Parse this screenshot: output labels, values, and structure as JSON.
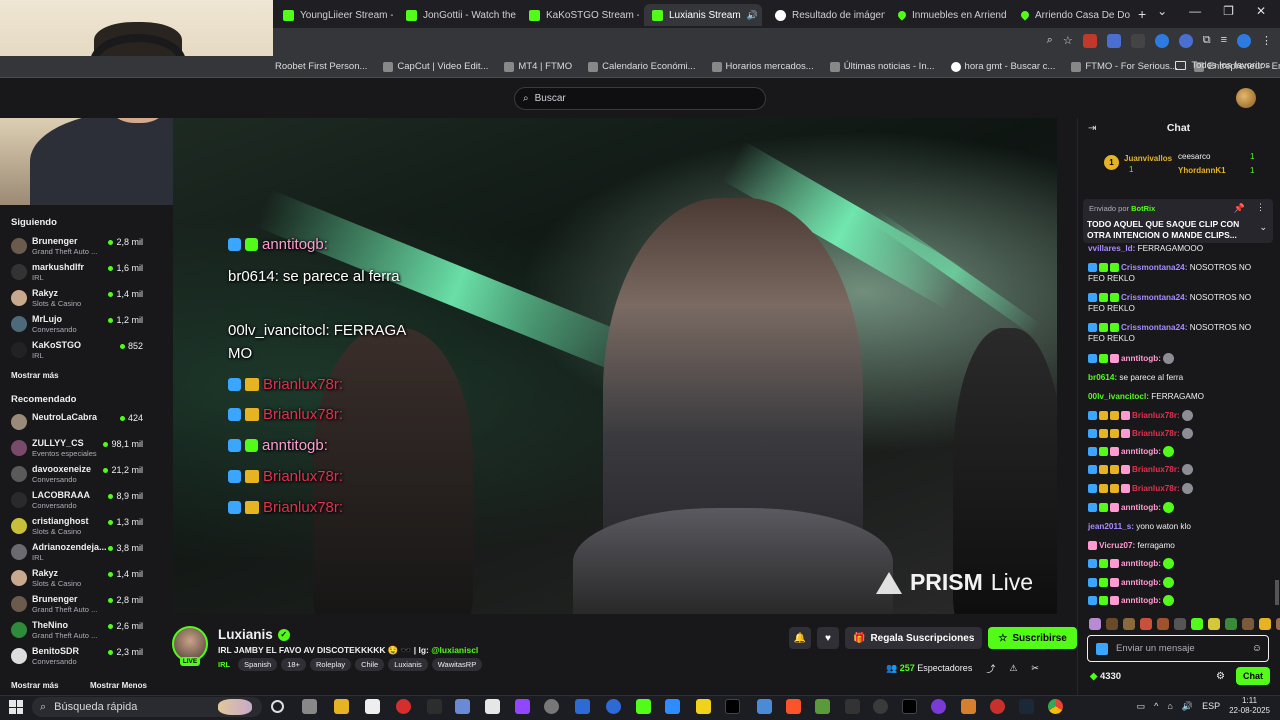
{
  "browser": {
    "tabs": [
      {
        "label": "YoungLiieer Stream -",
        "icon": "kick-icon"
      },
      {
        "label": "JonGottii - Watch the",
        "icon": "kick-icon"
      },
      {
        "label": "KaKoSTGO Stream -",
        "icon": "kick-icon"
      },
      {
        "label": "Luxianis Stream",
        "icon": "kick-icon",
        "active": true
      },
      {
        "label": "Resultado de imágen",
        "icon": "google-icon"
      },
      {
        "label": "Inmuebles en Arriend",
        "icon": "maps-icon"
      },
      {
        "label": "Arriendo Casa De Do",
        "icon": "maps-icon"
      }
    ],
    "new_tab": "+",
    "window_controls": [
      "⌄",
      "—",
      "❐",
      "✕"
    ],
    "bookmarks": [
      "Roobet First Person...",
      "CapCut | Video Edit...",
      "MT4 | FTMO",
      "Calendario Económi...",
      "Horarios mercados...",
      "Últimas noticias - In...",
      "hora gmt - Buscar c...",
      "FTMO - For Serious...",
      "Entrepreneur - Empi..."
    ],
    "bookmarks_more": "»",
    "bookmarks_folder": "Todos los favoritos"
  },
  "kick": {
    "search_placeholder": "Buscar"
  },
  "sidebar": {
    "following_heading": "Siguiendo",
    "following": [
      {
        "name": "Brunenger",
        "category": "Grand Theft Auto ...",
        "viewers": "2,8 mil"
      },
      {
        "name": "markushdlfr",
        "category": "IRL",
        "viewers": "1,6 mil"
      },
      {
        "name": "Rakyz",
        "category": "Slots & Casino",
        "viewers": "1,4 mil"
      },
      {
        "name": "MrLujo",
        "category": "Conversando",
        "viewers": "1,2 mil"
      },
      {
        "name": "KaKoSTGO",
        "category": "IRL",
        "viewers": "852"
      }
    ],
    "show_more": "Mostrar más",
    "recommended_heading": "Recomendado",
    "recommended": [
      {
        "name": "NeutroLaCabra",
        "category": "",
        "viewers": "424"
      },
      {
        "name": "ZULLYY_CS",
        "category": "Eventos especiales",
        "viewers": "98,1 mil"
      },
      {
        "name": "davooxeneize",
        "category": "Conversando",
        "viewers": "21,2 mil"
      },
      {
        "name": "LACOBRAAA",
        "category": "Conversando",
        "viewers": "8,9 mil"
      },
      {
        "name": "cristianghost",
        "category": "Slots & Casino",
        "viewers": "1,3 mil"
      },
      {
        "name": "Adrianozendeja...",
        "category": "IRL",
        "viewers": "3,8 mil"
      },
      {
        "name": "Rakyz",
        "category": "Slots & Casino",
        "viewers": "1,4 mil"
      },
      {
        "name": "Brunenger",
        "category": "Grand Theft Auto ...",
        "viewers": "2,8 mil"
      },
      {
        "name": "TheNino",
        "category": "Grand Theft Auto ...",
        "viewers": "2,6 mil"
      },
      {
        "name": "BenitoSDR",
        "category": "Conversando",
        "viewers": "2,3 mil"
      }
    ],
    "show_more_2": "Mostrar más",
    "show_less": "Mostrar Menos"
  },
  "video_overlay": {
    "lines": [
      {
        "user": "anntitogb:",
        "text": ""
      },
      {
        "user": "br0614:",
        "text": "se parece al ferra"
      },
      {
        "user": "00lv_ivancitocl:",
        "text": "FERRAGA"
      },
      {
        "user": "",
        "text": "MO"
      },
      {
        "user": "Brianlux78r:",
        "text": ""
      },
      {
        "user": "Brianlux78r:",
        "text": ""
      },
      {
        "user": "anntitogb:",
        "text": ""
      },
      {
        "user": "Brianlux78r:",
        "text": ""
      },
      {
        "user": "Brianlux78r:",
        "text": ""
      }
    ],
    "watermark": "PRISM",
    "watermark_suffix": "Live"
  },
  "stream": {
    "channel": "Luxianis",
    "live_badge": "LIVE",
    "title": "IRL JAMBY EL FAVO AV DISCOTEKKKKK 🤤 🕶️ | Ig:",
    "instagram": "@luxianiscl",
    "category": "IRL",
    "tags": [
      "Spanish",
      "18+",
      "Roleplay",
      "Chile",
      "Luxianis",
      "WawitasRP"
    ],
    "gift_label": "Regala Suscripciones",
    "subscribe_label": "Suscribirse",
    "viewers": "257",
    "viewers_label": "Espectadores"
  },
  "chat": {
    "title": "Chat",
    "leaderboard": [
      {
        "rank": "1",
        "name": "Juanvivallos",
        "count": "1"
      },
      {
        "name": "ceesarco",
        "count": "1"
      },
      {
        "name": "YhordannK1",
        "count": "1"
      }
    ],
    "pinned_by_prefix": "Enviado por",
    "pinned_by": "BotRix",
    "pinned_text": "TODO AQUEL QUE SAQUE CLIP CON OTRA INTENCION O MANDE CLIPS...",
    "messages": [
      {
        "user": "vvillares_ld:",
        "text": "FERRAGAMOOO",
        "color": "#a98bff"
      },
      {
        "user": "Crissmontana24:",
        "text": "NOSOTROS NO FEO REKLO",
        "color": "#a98bff"
      },
      {
        "user": "Crissmontana24:",
        "text": "NOSOTROS NO FEO REKLO",
        "color": "#a98bff"
      },
      {
        "user": "Crissmontana24:",
        "text": "NOSOTROS NO FEO REKLO",
        "color": "#a98bff"
      },
      {
        "user": "anntitogb:",
        "text": "",
        "color": "#ff9bd0"
      },
      {
        "user": "br0614:",
        "text": "se parece al ferra",
        "color": "#53fc18"
      },
      {
        "user": "00lv_ivancitocl:",
        "text": "FERRAGAMO",
        "color": "#53fc18"
      },
      {
        "user": "Brianlux78r:",
        "text": "",
        "color": "#e0314f"
      },
      {
        "user": "Brianlux78r:",
        "text": "",
        "color": "#e0314f"
      },
      {
        "user": "anntitogb:",
        "text": "",
        "color": "#ff9bd0"
      },
      {
        "user": "Brianlux78r:",
        "text": "",
        "color": "#e0314f"
      },
      {
        "user": "Brianlux78r:",
        "text": "",
        "color": "#e0314f"
      },
      {
        "user": "anntitogb:",
        "text": "",
        "color": "#ff9bd0"
      },
      {
        "user": "jean2011_s:",
        "text": "yono waton klo",
        "color": "#a98bff"
      },
      {
        "user": "Vicruz07:",
        "text": "ferragamo",
        "color": "#ff9bd0"
      },
      {
        "user": "anntitogb:",
        "text": "",
        "color": "#ff9bd0"
      },
      {
        "user": "anntitogb:",
        "text": "",
        "color": "#ff9bd0"
      },
      {
        "user": "anntitogb:",
        "text": "",
        "color": "#ff9bd0"
      }
    ],
    "input_placeholder": "Enviar un mensaje",
    "points": "4330",
    "send_label": "Chat"
  },
  "taskbar": {
    "search_placeholder": "Búsqueda rápida",
    "language": "ESP",
    "time": "1:11",
    "date": "22-08-2025"
  },
  "colors": {
    "kick_green": "#53fc18",
    "background": "#18181b",
    "panel": "#2f2f35"
  }
}
